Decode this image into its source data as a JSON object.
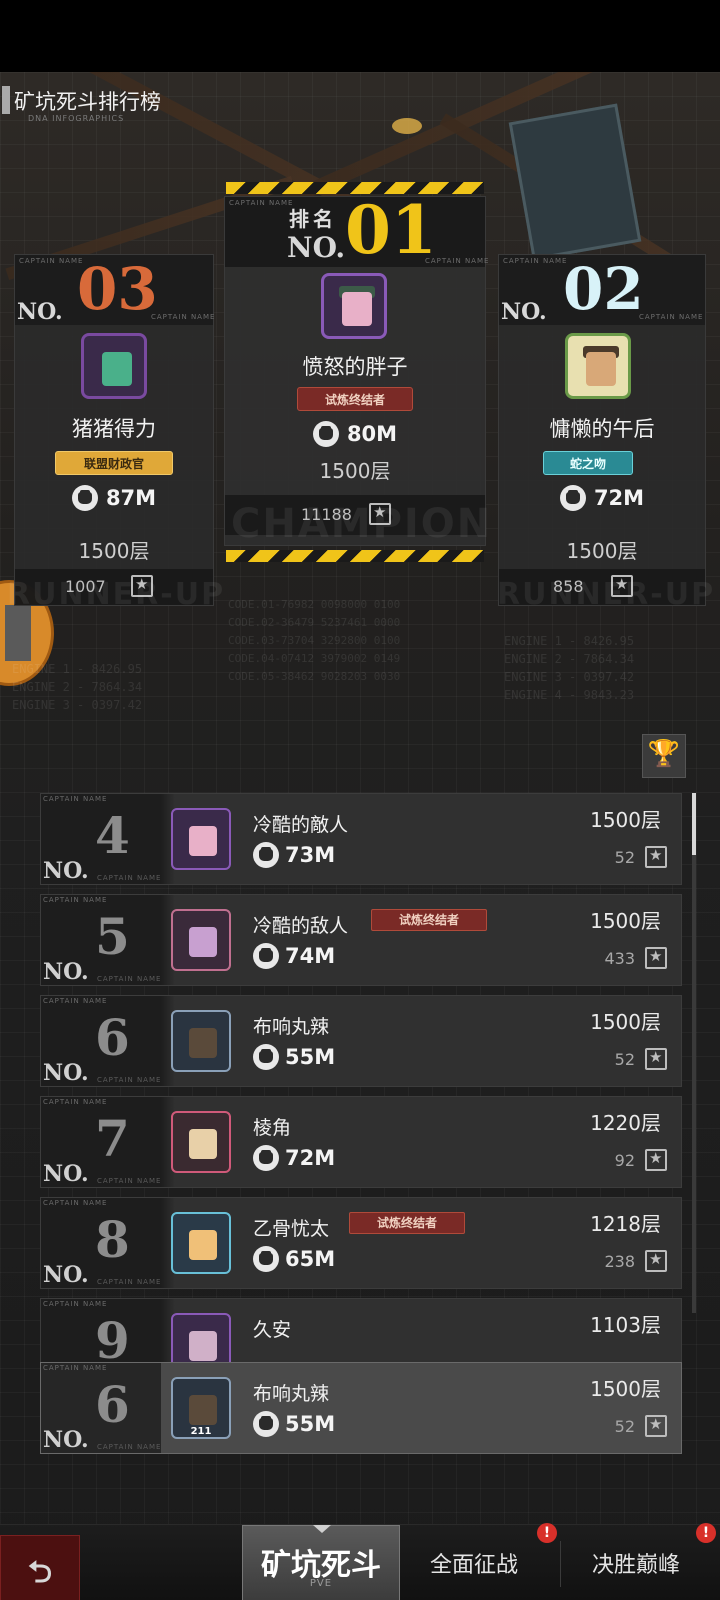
{
  "header": {
    "title": "矿坑死斗排行榜",
    "subtitle": "DNA INFOGRAPHICS"
  },
  "labels": {
    "rank_cn": "排名",
    "no": "NO.",
    "captain": "CAPTAIN NAME",
    "champion_wm": "CHAMPION",
    "runner_up_wm": "RUNNER-UP"
  },
  "podium": {
    "first": {
      "rank": "01",
      "name": "愤怒的胖子",
      "badge": "试炼终结者",
      "power": "80M",
      "floor": "1500层",
      "likes": "11188"
    },
    "second": {
      "rank": "02",
      "name": "慵懒的午后",
      "badge": "蛇之吻",
      "power": "72M",
      "floor": "1500层",
      "likes": "858"
    },
    "third": {
      "rank": "03",
      "name": "猪猪得力",
      "badge": "联盟财政官",
      "power": "87M",
      "floor": "1500层",
      "likes": "1007"
    }
  },
  "code_text": {
    "left": "ENGINE 1 - 8426.95\nENGINE 2 - 7864.34\nENGINE 3 - 0397.42",
    "center": "CODE.01-76982 0098000 0100\nCODE.02-36479 5237461 0000\nCODE.03-73704 3292800 0100\nCODE.04-07412 3979002 0149\nCODE.05-38462 9028203 0030",
    "right": "ENGINE 1 - 8426.95\nENGINE 2 - 7864.34\nENGINE 3 - 0397.42\nENGINE 4 - 9843.23"
  },
  "list": {
    "rows": [
      {
        "rank": "4",
        "name": "冷酷的敵人",
        "power": "73M",
        "floor": "1500层",
        "likes": "52",
        "badge": ""
      },
      {
        "rank": "5",
        "name": "冷酷的敌人",
        "power": "74M",
        "floor": "1500层",
        "likes": "433",
        "badge": "试炼终结者"
      },
      {
        "rank": "6",
        "name": "布响丸辣",
        "power": "55M",
        "floor": "1500层",
        "likes": "52",
        "badge": ""
      },
      {
        "rank": "7",
        "name": "棱角",
        "power": "72M",
        "floor": "1220层",
        "likes": "92",
        "badge": ""
      },
      {
        "rank": "8",
        "name": "乙骨忧太",
        "power": "65M",
        "floor": "1218层",
        "likes": "238",
        "badge": "试炼终结者"
      },
      {
        "rank": "9",
        "name": "久安",
        "power": "",
        "floor": "1103层",
        "likes": "",
        "badge": ""
      }
    ],
    "my_rank": {
      "rank": "6",
      "name": "布响丸辣",
      "power": "55M",
      "floor": "1500层",
      "likes": "52",
      "avatar_level": "211"
    }
  },
  "nav": {
    "back_icon": "back-arrow-icon",
    "active_tab": "矿坑死斗",
    "active_sub": "PVE",
    "tab2": "全面征战",
    "tab3": "决胜巅峰",
    "alert": "!"
  },
  "colors": {
    "gold": "#f0c419",
    "third_orange": "#d86a3a",
    "second_cyan": "#d8f2f8",
    "badge_red": "#7a2a26"
  }
}
